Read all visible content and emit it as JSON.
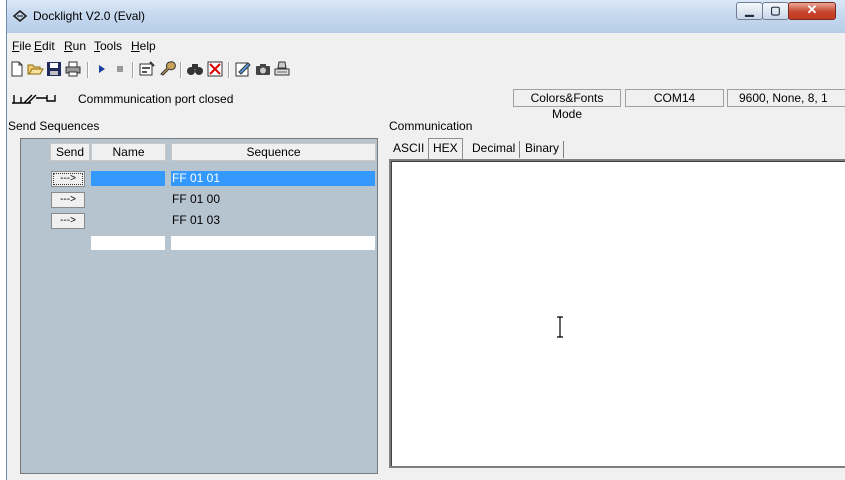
{
  "window": {
    "title": "Docklight V2.0 (Eval)"
  },
  "menu": [
    {
      "label": "File"
    },
    {
      "label": "Edit"
    },
    {
      "label": "Run"
    },
    {
      "label": "Tools"
    },
    {
      "label": "Help"
    }
  ],
  "toolbar": {
    "icons": [
      "new-file-icon",
      "open-folder-icon",
      "save-icon",
      "print-icon",
      "run-icon",
      "stop-icon",
      "settings-icon",
      "send-command-icon",
      "find-icon",
      "clear-icon",
      "edit-icon",
      "snapshot-icon",
      "keyboard-icon"
    ]
  },
  "status": {
    "port": "Commmunication port closed",
    "mode": "Colors&Fonts Mode",
    "com": "COM14",
    "settings": "9600, None, 8, 1"
  },
  "send_sequences": {
    "label": "Send Sequences",
    "columns": {
      "send": "Send",
      "name": "Name",
      "sequence": "Sequence"
    },
    "rows": [
      {
        "button": "--->",
        "name": "",
        "sequence": "FF 01 01"
      },
      {
        "button": "--->",
        "name": "",
        "sequence": "FF 01 00"
      },
      {
        "button": "--->",
        "name": "",
        "sequence": "FF 01 03"
      }
    ]
  },
  "communication": {
    "label": "Communication",
    "tabs": [
      {
        "label": "ASCII"
      },
      {
        "label": "HEX"
      },
      {
        "label": "Decimal"
      },
      {
        "label": "Binary"
      }
    ],
    "active_tab": "HEX"
  },
  "colors": {
    "selection": "#3399ff",
    "panel": "#b6c4d0",
    "titlebar": "#c6d9ef"
  }
}
